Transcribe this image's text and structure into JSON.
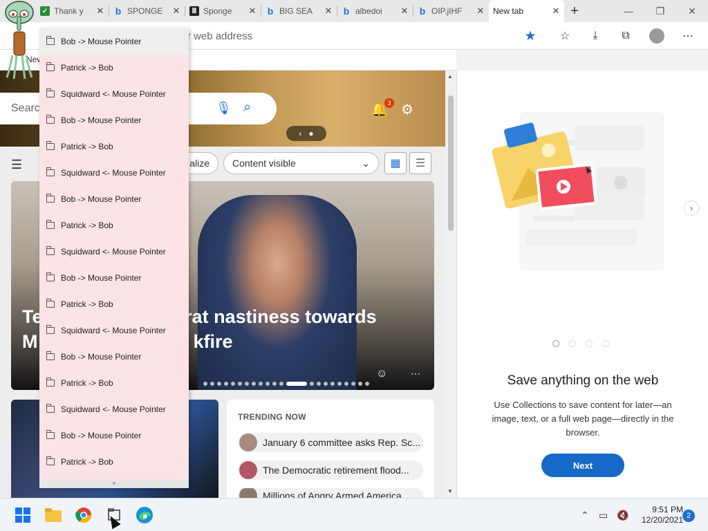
{
  "browser": {
    "tabs": [
      {
        "label": "Thank y",
        "icon": "check-icon"
      },
      {
        "label": "SPONGE",
        "icon": "bing-icon"
      },
      {
        "label": "Sponge",
        "icon": "book-icon"
      },
      {
        "label": "BIG SEA",
        "icon": "bing-icon"
      },
      {
        "label": "albedoi",
        "icon": "bing-icon"
      },
      {
        "label": "OIP.jIHF",
        "icon": "bing-icon"
      },
      {
        "label": "New tab",
        "icon": "page-icon",
        "active": true
      }
    ],
    "new_tab_symbol": "+",
    "address_placeholder": "nter web address",
    "bookmark_label": "New",
    "window_controls": [
      "—",
      "❐",
      "✕"
    ]
  },
  "page": {
    "search_placeholder": "Search",
    "notification_count": "3",
    "chips": [
      "alize",
      "Content visible"
    ],
    "headline": "Te                    mocrat nastiness towards\nM                              kfire",
    "trending_title": "TRENDING NOW",
    "trending": [
      "January 6 committee asks Rep. Sc...",
      "The Democratic retirement flood...",
      "Millions of Angry Armed America..."
    ]
  },
  "collections": {
    "title": "Save anything on the web",
    "description": "Use Collections to save content for later—an image, text, or a full web page—directly in the browser.",
    "next_label": "Next"
  },
  "dropdown": {
    "items": [
      "Bob -> Mouse Pointer",
      "Patrick -> Bob",
      "Squidward <- Mouse Pointer",
      "Bob -> Mouse Pointer",
      "Patrick -> Bob",
      "Squidward <- Mouse Pointer",
      "Bob -> Mouse Pointer",
      "Patrick -> Bob",
      "Squidward <- Mouse Pointer",
      "Bob -> Mouse Pointer",
      "Patrick -> Bob",
      "Squidward <- Mouse Pointer",
      "Bob -> Mouse Pointer",
      "Patrick -> Bob",
      "Squidward <- Mouse Pointer",
      "Bob -> Mouse Pointer",
      "Patrick -> Bob"
    ]
  },
  "taskbar": {
    "time": "9:51 PM",
    "date": "12/20/2021",
    "notifications": "2"
  },
  "colors": {
    "accent": "#1569c7",
    "dropdown_bg": "#fbe3e6",
    "badge": "#d83b01"
  }
}
